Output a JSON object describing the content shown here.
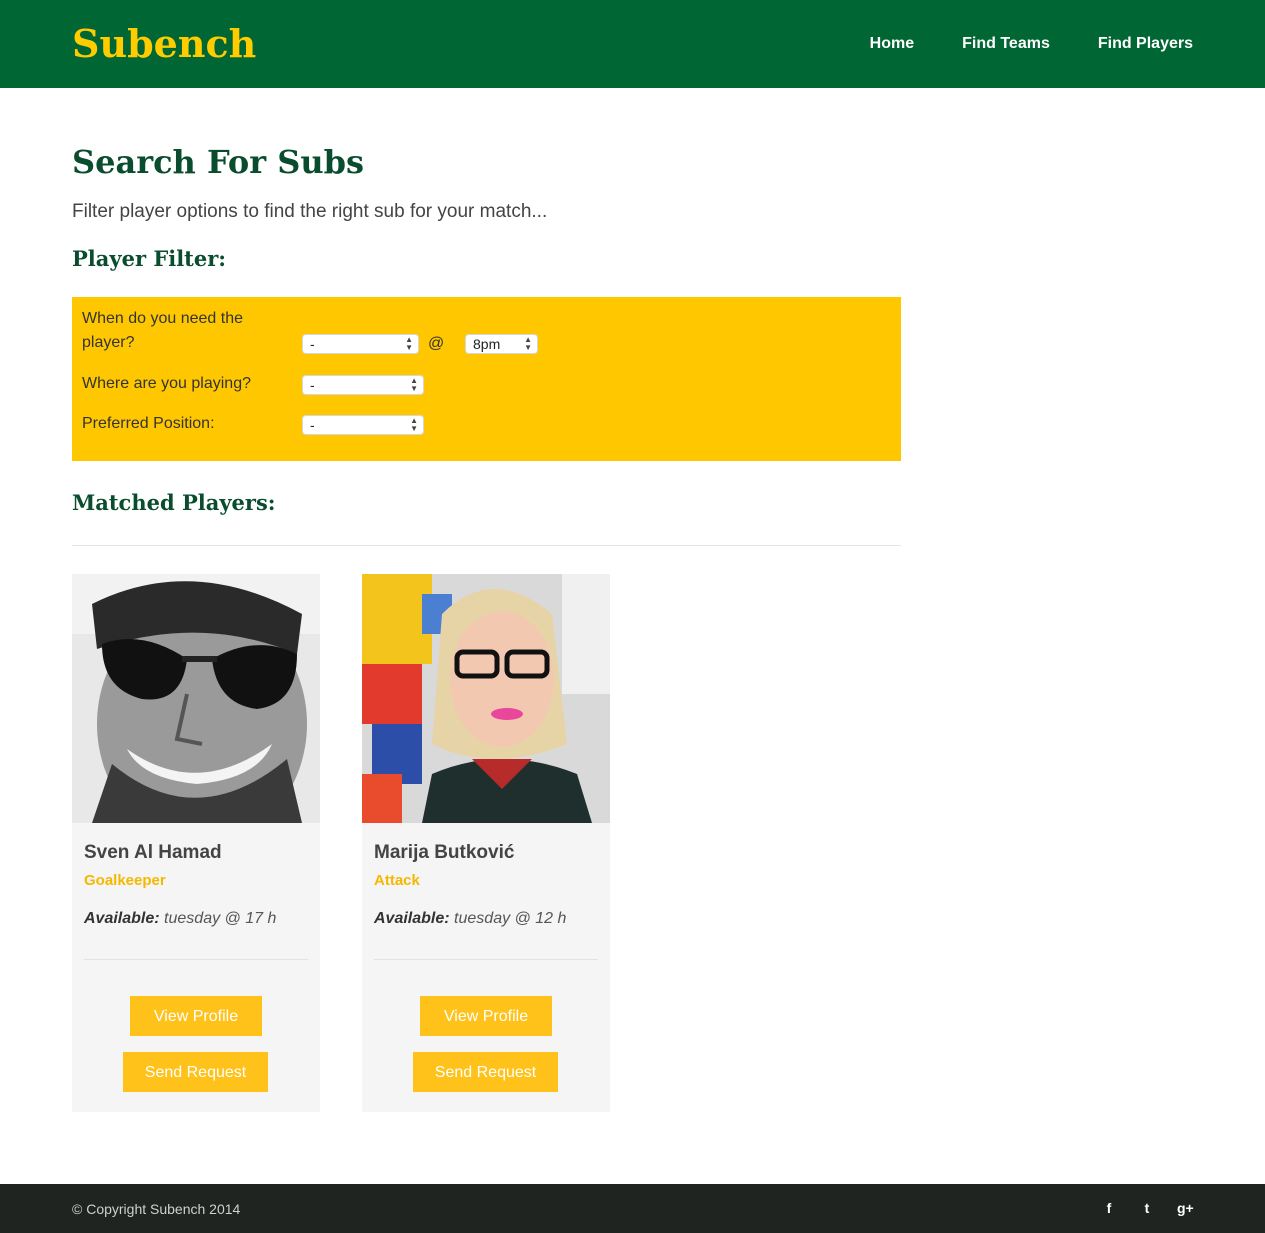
{
  "header": {
    "logo": "Subench",
    "nav": [
      {
        "label": "Home"
      },
      {
        "label": "Find Teams"
      },
      {
        "label": "Find Players"
      }
    ]
  },
  "main": {
    "title": "Search For Subs",
    "intro": "Filter player options to find the right sub for your match...",
    "filter_title": "Player Filter:",
    "filter": {
      "when_label": "When do you need the player?",
      "when_day_value": "-",
      "at_sign": "@",
      "when_time_value": "8pm",
      "where_label": "Where are you playing?",
      "where_value": "-",
      "position_label": "Preferred Position:",
      "position_value": "-"
    },
    "matched_title": "Matched Players:",
    "players": [
      {
        "name": "Sven Al Hamad",
        "position": "Goalkeeper",
        "available_label": "Available:",
        "available_value": "tuesday @ 17 h",
        "view_label": "View Profile",
        "request_label": "Send Request"
      },
      {
        "name": "Marija Butković",
        "position": "Attack",
        "available_label": "Available:",
        "available_value": "tuesday @ 12 h",
        "view_label": "View Profile",
        "request_label": "Send Request"
      }
    ]
  },
  "footer": {
    "copyright": "© Copyright Subench 2014",
    "social": [
      {
        "icon": "facebook-icon",
        "glyph": "f"
      },
      {
        "icon": "twitter-icon",
        "glyph": "t"
      },
      {
        "icon": "google-plus-icon",
        "glyph": "g+"
      }
    ]
  },
  "colors": {
    "header_bg": "#006633",
    "accent": "#ffcc00",
    "heading": "#0a4d2e",
    "button": "#ffc21a",
    "footer_bg": "#1f2420"
  }
}
